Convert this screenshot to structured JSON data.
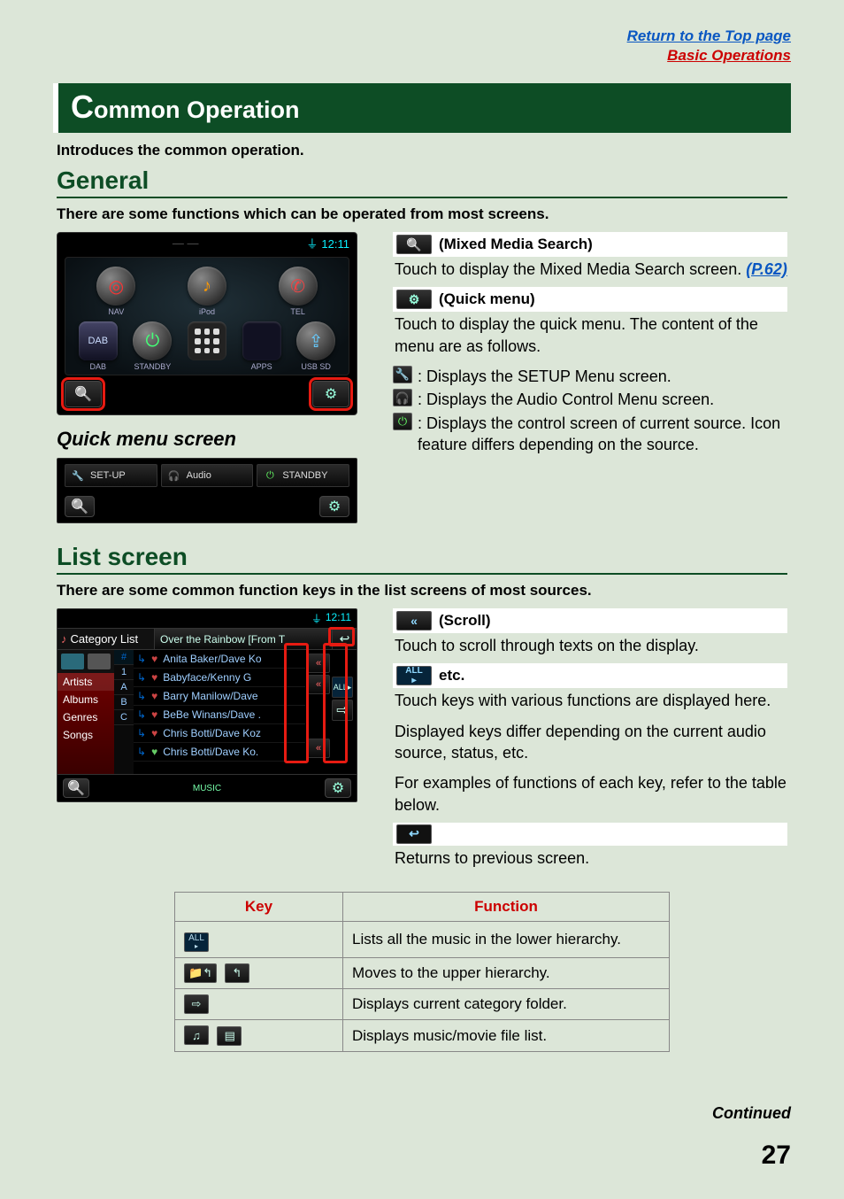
{
  "top_links": {
    "top": "Return to the Top page",
    "basic": "Basic Operations"
  },
  "title": "ommon Operation",
  "title_cap": "C",
  "intro": "Introduces the common operation.",
  "general": {
    "heading": "General",
    "lead": "There are some functions which can be operated from most screens.",
    "quick_menu_heading": "Quick menu screen"
  },
  "home": {
    "time": "12:11",
    "row1": [
      {
        "label": "NAV"
      },
      {
        "label": "iPod"
      },
      {
        "label": "TEL"
      }
    ],
    "row2": [
      {
        "label": "DAB"
      },
      {
        "label": "STANDBY"
      },
      {
        "label": ""
      },
      {
        "label": "APPS"
      },
      {
        "label": "USB SD"
      }
    ]
  },
  "qbar": {
    "setup": "SET-UP",
    "audio": "Audio",
    "standby": "STANDBY"
  },
  "desc_general": {
    "h1": "(Mixed Media Search)",
    "t1a": "Touch to display the Mixed Media Search screen. ",
    "t1link": "(P.62)",
    "h2": "(Quick menu)",
    "t2": "Touch to display the quick menu. The content of the menu are as follows.",
    "b1": ": Displays the SETUP Menu screen.",
    "b2": ": Displays the Audio Control Menu screen.",
    "b3": ": Displays the control screen of current source. Icon feature differs depending on the source."
  },
  "list": {
    "heading": "List screen",
    "lead": "There are some common function keys in the list screens of most sources.",
    "time": "12:11",
    "cat_title": "Category List",
    "now": "Over the Rainbow [From T",
    "side": [
      "Artists",
      "Albums",
      "Genres",
      "Songs"
    ],
    "az": [
      "#",
      "1",
      "A",
      "B",
      "C"
    ],
    "rows": [
      "Anita Baker/Dave Ko",
      "Babyface/Kenny G",
      "Barry Manilow/Dave",
      "BeBe Winans/Dave .",
      "Chris Botti/Dave Koz",
      "Chris Botti/Dave Ko."
    ],
    "all": "ALL",
    "music": "MUSIC"
  },
  "desc_list": {
    "h1": "(Scroll)",
    "t1": "Touch to scroll through texts on the display.",
    "h2": "etc.",
    "t2a": "Touch keys with various functions are displayed here.",
    "t2b": "Displayed keys differ depending on the current audio source, status, etc.",
    "t2c": "For examples of functions of each key, refer to the table below.",
    "t3": "Returns to previous screen."
  },
  "table": {
    "key": "Key",
    "function": "Function",
    "rows": [
      {
        "fn": "Lists all the music in the lower hierarchy."
      },
      {
        "fn": "Moves to the upper hierarchy."
      },
      {
        "fn": "Displays current category folder."
      },
      {
        "fn": "Displays music/movie file list."
      }
    ]
  },
  "continued": "Continued",
  "page": "27"
}
